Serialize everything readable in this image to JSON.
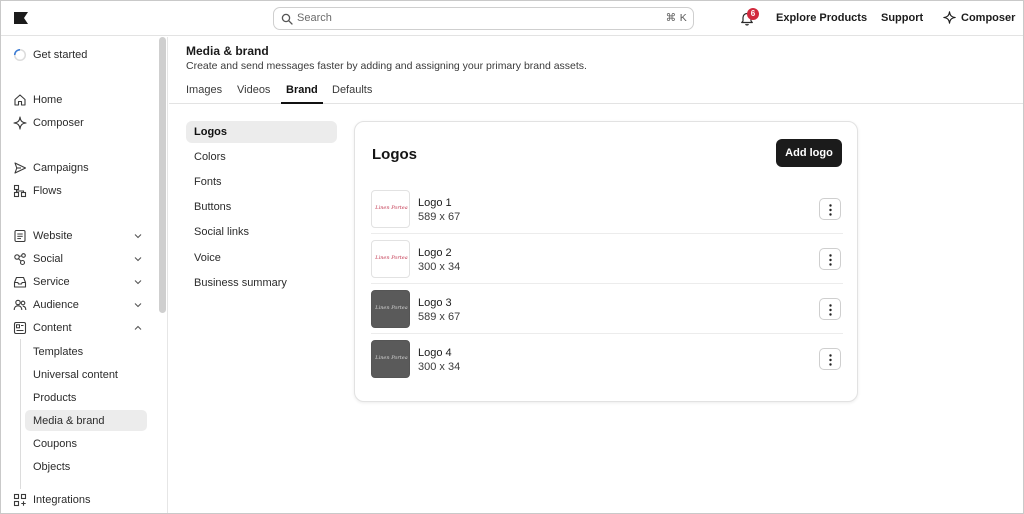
{
  "topbar": {
    "logo_icon": "klaviyo-flag-icon",
    "search_placeholder": "Search",
    "search_shortcut": "⌘ K",
    "notifications_count": "6",
    "explore_products": "Explore Products",
    "support": "Support",
    "composer": "Composer"
  },
  "sidebar": {
    "get_started": "Get started",
    "items": [
      {
        "label": "Home",
        "icon": "home-icon"
      },
      {
        "label": "Composer",
        "icon": "sparkle-icon"
      },
      {
        "label": "Campaigns",
        "icon": "send-icon"
      },
      {
        "label": "Flows",
        "icon": "flow-icon"
      },
      {
        "label": "Website",
        "icon": "document-icon"
      },
      {
        "label": "Social",
        "icon": "share-icon"
      },
      {
        "label": "Service",
        "icon": "inbox-icon"
      },
      {
        "label": "Audience",
        "icon": "people-icon"
      },
      {
        "label": "Content",
        "icon": "content-icon"
      },
      {
        "label": "Integrations",
        "icon": "grid-plus-icon"
      }
    ],
    "content_sub": [
      "Templates",
      "Universal content",
      "Products",
      "Media & brand",
      "Coupons",
      "Objects"
    ]
  },
  "main": {
    "title": "Media & brand",
    "subtitle": "Create and send messages faster by adding and assigning your primary brand assets.",
    "tabs": [
      "Images",
      "Videos",
      "Brand",
      "Defaults"
    ],
    "active_tab": "Brand",
    "subnav": [
      "Logos",
      "Colors",
      "Fonts",
      "Buttons",
      "Social links",
      "Voice",
      "Business summary"
    ],
    "active_subnav": "Logos",
    "card": {
      "title": "Logos",
      "add_button": "Add logo",
      "logos": [
        {
          "name": "Logo 1",
          "dims": "589 x 67",
          "thumb_text": "Linen Portea",
          "style": "light"
        },
        {
          "name": "Logo 2",
          "dims": "300 x 34",
          "thumb_text": "Linen Portea",
          "style": "light"
        },
        {
          "name": "Logo 3",
          "dims": "589 x 67",
          "thumb_text": "Linen Portea",
          "style": "dark"
        },
        {
          "name": "Logo 4",
          "dims": "300 x 34",
          "thumb_text": "Linen Portea",
          "style": "dark"
        }
      ]
    }
  },
  "colors": {
    "accent_dark": "#1b1b1b",
    "badge_red": "#d1293d",
    "active_bg": "#ececec"
  }
}
